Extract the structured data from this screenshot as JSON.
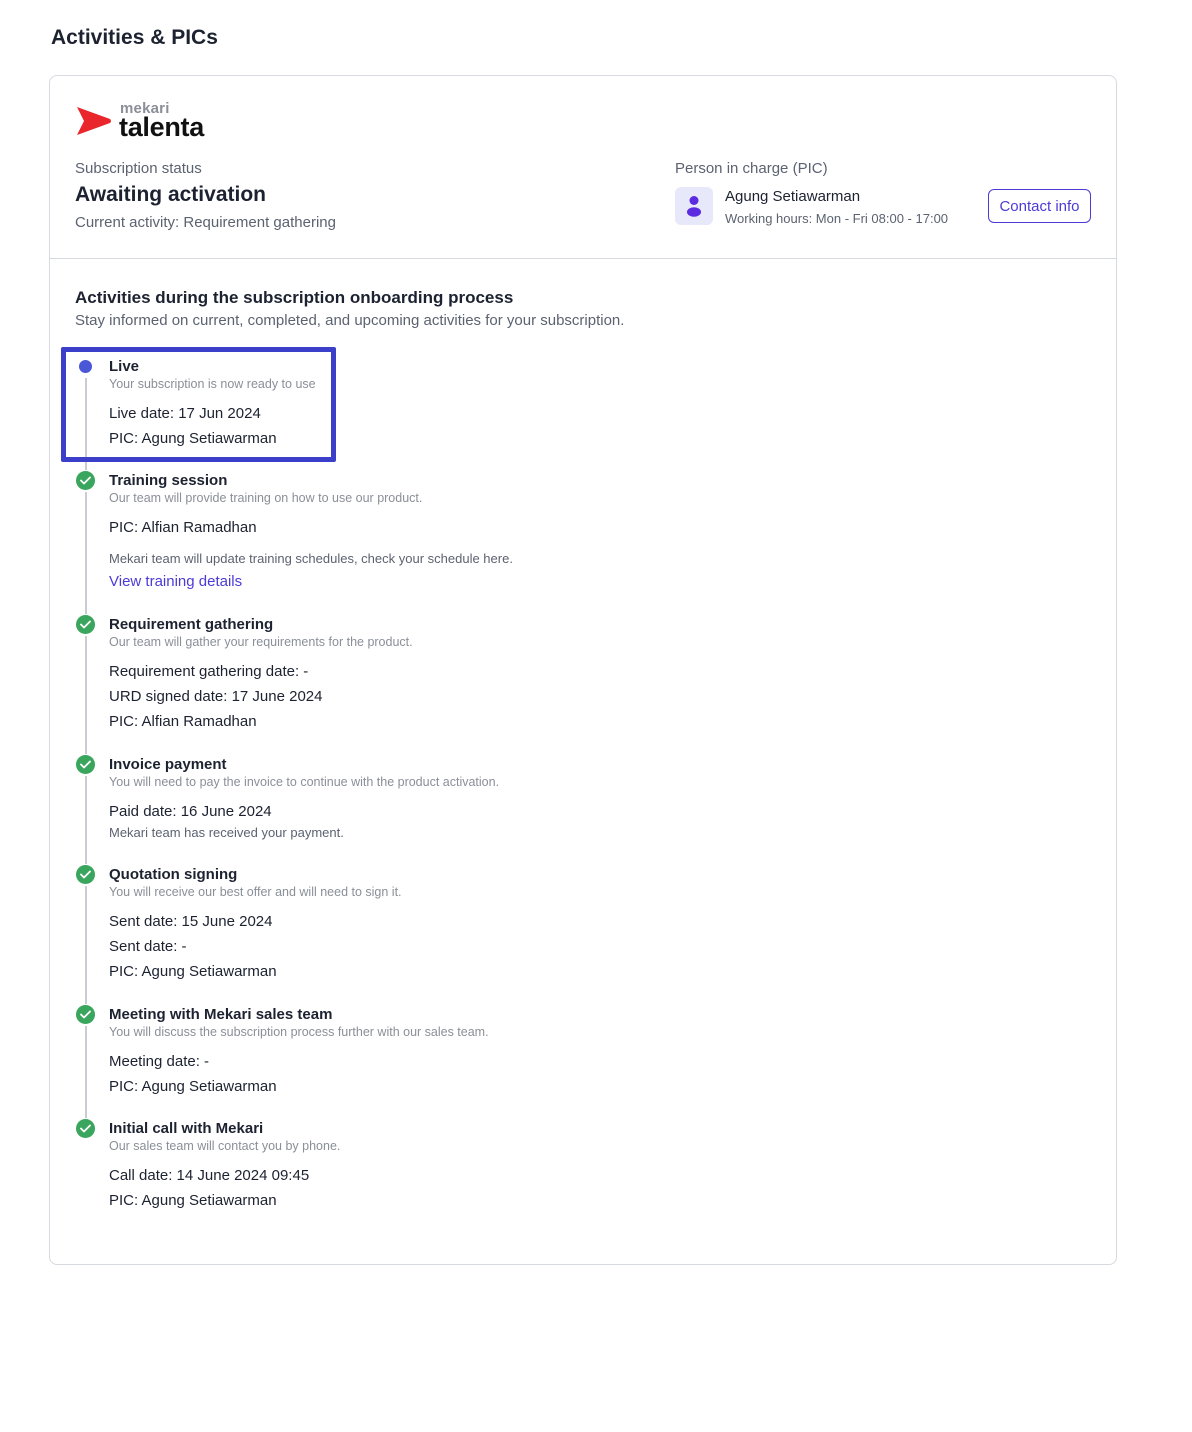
{
  "page": {
    "title": "Activities & PICs"
  },
  "logo": {
    "brand": "mekari",
    "product": "talenta",
    "mark_color": "#e8262c"
  },
  "subscription": {
    "status_label": "Subscription status",
    "status_value": "Awaiting activation",
    "current_activity": "Current activity: Requirement gathering"
  },
  "pic": {
    "label": "Person in charge (PIC)",
    "name": "Agung Setiawarman",
    "hours": "Working hours: Mon - Fri 08:00 - 17:00",
    "contact_button": "Contact info",
    "avatar_icon": "user-icon"
  },
  "activities": {
    "title": "Activities during the subscription onboarding process",
    "description": "Stay informed on current, completed, and upcoming activities for your subscription.",
    "items": [
      {
        "status": "current",
        "title": "Live",
        "subtitle": "Your subscription is now ready to use",
        "details": [
          "Live date: 17 Jun 2024",
          "PIC: Agung Setiawarman"
        ]
      },
      {
        "status": "done",
        "title": "Training session",
        "subtitle": "Our team will provide training on how to use our product.",
        "details": [
          "PIC: Alfian Ramadhan"
        ],
        "note": "Mekari team will update training schedules, check your schedule here.",
        "link": "View training details"
      },
      {
        "status": "done",
        "title": "Requirement gathering",
        "subtitle": "Our team will gather your requirements for the product.",
        "details": [
          "Requirement gathering date: -",
          "URD signed date: 17 June 2024",
          "PIC: Alfian Ramadhan"
        ]
      },
      {
        "status": "done",
        "title": "Invoice payment",
        "subtitle": "You will need to pay the invoice to continue with the product activation.",
        "details": [
          "Paid date: 16 June 2024"
        ],
        "note": "Mekari team has received your payment."
      },
      {
        "status": "done",
        "title": "Quotation signing",
        "subtitle": "You will receive our best offer and will need to sign it.",
        "details": [
          "Sent date: 15 June 2024",
          "Sent date: -",
          "PIC: Agung Setiawarman"
        ]
      },
      {
        "status": "done",
        "title": "Meeting with Mekari sales team",
        "subtitle": "You will discuss the subscription process further with our sales team.",
        "details": [
          "Meeting date: -",
          "PIC: Agung Setiawarman"
        ]
      },
      {
        "status": "done",
        "title": "Initial call with Mekari",
        "subtitle": "Our sales team will contact you by phone.",
        "details": [
          "Call date: 14 June 2024 09:45",
          "PIC: Agung Setiawarman"
        ]
      }
    ]
  },
  "colors": {
    "accent": "#4b3bd6",
    "success": "#3aa55d",
    "current_dot": "#4a58d8",
    "highlight": "#3b3fc9"
  }
}
